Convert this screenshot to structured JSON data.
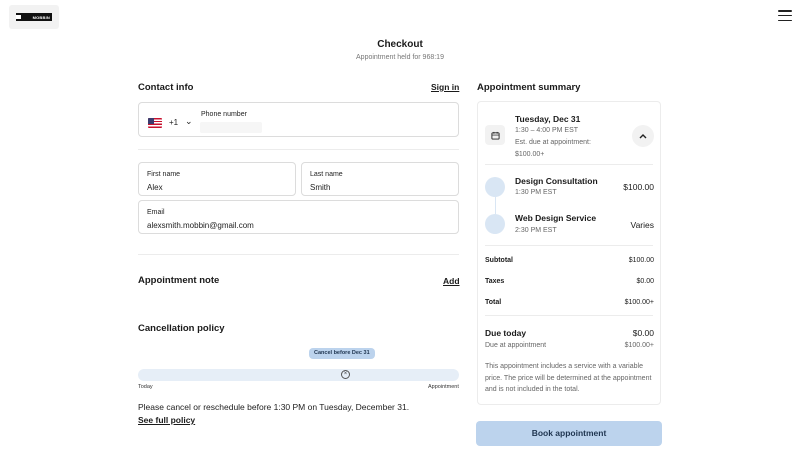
{
  "logo": {
    "text": "MOBBIN"
  },
  "header": {
    "title": "Checkout",
    "subtitle": "Appointment held for 968:19"
  },
  "contact": {
    "title": "Contact info",
    "sign_in": "Sign in",
    "country_code": "+1",
    "phone_label": "Phone number",
    "first_name_label": "First name",
    "first_name": "Alex",
    "last_name_label": "Last name",
    "last_name": "Smith",
    "email_label": "Email",
    "email": "alexsmith.mobbin@gmail.com"
  },
  "note": {
    "title": "Appointment note",
    "add": "Add"
  },
  "cancellation": {
    "title": "Cancellation policy",
    "pill": "Cancel before Dec 31",
    "start_label": "Today",
    "end_label": "Appointment",
    "text": "Please cancel or reschedule before 1:30 PM on Tuesday, December 31.",
    "full_policy": "See full policy"
  },
  "summary": {
    "title": "Appointment summary",
    "date": "Tuesday, Dec 31",
    "time": "1:30 – 4:00 PM EST",
    "est_line1": "Est. due at appointment:",
    "est_line2": "$100.00+",
    "services": [
      {
        "name": "Design Consultation",
        "time": "1:30 PM EST",
        "price": "$100.00"
      },
      {
        "name": "Web Design Service",
        "time": "2:30 PM EST",
        "price": "Varies"
      }
    ],
    "subtotal_label": "Subtotal",
    "subtotal": "$100.00",
    "taxes_label": "Taxes",
    "taxes": "$0.00",
    "total_label": "Total",
    "total": "$100.00+",
    "due_today_label": "Due today",
    "due_today": "$0.00",
    "due_appt_label": "Due at appointment",
    "due_appt": "$100.00+",
    "variable_note": "This appointment includes a service with a variable price. The price will be determined at the appointment and is not included in the total."
  },
  "book_button": "Book appointment",
  "icons": {
    "menu": "hamburger-menu-icon",
    "flag": "us-flag-icon",
    "chevron": "chevron-down-icon",
    "calendar": "calendar-icon",
    "collapse": "chevron-up-icon",
    "clear": "close-circle-icon"
  },
  "colors": {
    "accent": "#bcd3ed",
    "accent_text": "#1f3550",
    "track": "#e6eef7",
    "service_dot": "#d9e6f4"
  }
}
